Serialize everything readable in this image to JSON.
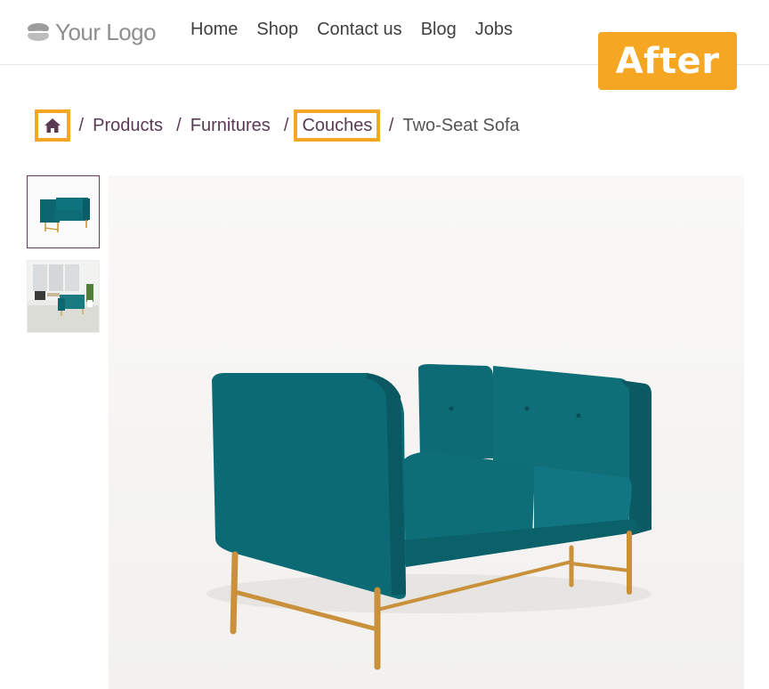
{
  "header": {
    "logo_text": "Your Logo",
    "nav": [
      "Home",
      "Shop",
      "Contact us",
      "Blog",
      "Jobs"
    ]
  },
  "badge": "After",
  "breadcrumb": {
    "home_icon": "home-icon",
    "items": [
      "Products",
      "Furnitures",
      "Couches"
    ],
    "current": "Two-Seat Sofa"
  },
  "product": {
    "thumbnails": [
      "sofa-front-thumbnail",
      "sofa-room-thumbnail"
    ],
    "main_image": "teal two-seat sofa"
  },
  "colors": {
    "accent_highlight": "#f5a623",
    "breadcrumb_text": "#5a3a55",
    "sofa_teal": "#0b6670",
    "legs_gold": "#c9913b"
  }
}
